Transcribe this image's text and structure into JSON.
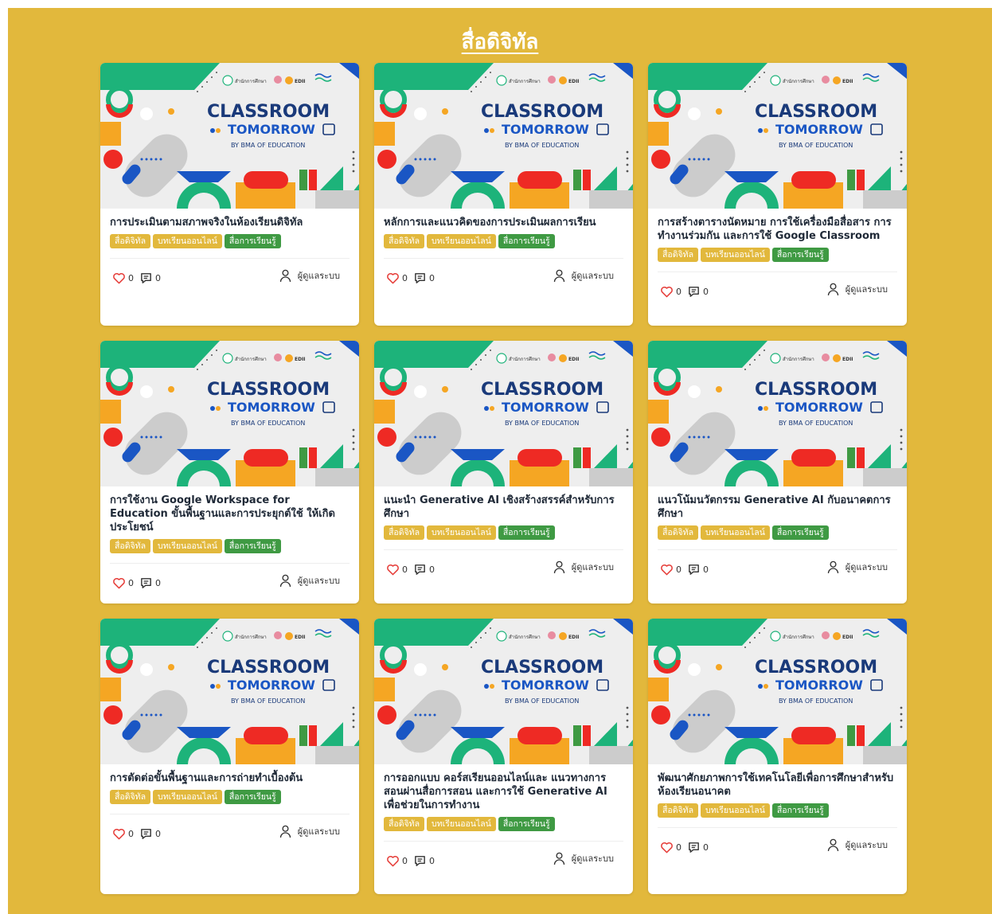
{
  "section": {
    "title": "สื่อดิจิทัล"
  },
  "thumbnail": {
    "brand_line1": "CLASSROOM",
    "brand_line2": "TOMORROW",
    "brand_line3": "BY BMA OF EDUCATION",
    "logo_text": "สำนักการศึกษา",
    "logo_edu": "EDII"
  },
  "tags": [
    "สื่อดิจิทัล",
    "บทเรียนออนไลน์",
    "สื่อการเรียนรู้"
  ],
  "cards": [
    {
      "title": "การประเมินตามสภาพจริงในห้องเรียนดิจิทัล",
      "likes": "0",
      "comments": "0",
      "author": "ผู้ดูแลระบบ"
    },
    {
      "title": "หลักการและแนวคิดของการประเมินผลการเรียน",
      "likes": "0",
      "comments": "0",
      "author": "ผู้ดูแลระบบ"
    },
    {
      "title": "การสร้างตารางนัดหมาย การใช้เครื่องมือสื่อสาร การทำงานร่วมกัน และการใช้ Google Classroom",
      "likes": "0",
      "comments": "0",
      "author": "ผู้ดูแลระบบ"
    },
    {
      "title": "การใช้งาน Google Workspace for Education ขั้นพื้นฐานและการประยุกต์ใช้ ให้เกิดประโยชน์",
      "likes": "0",
      "comments": "0",
      "author": "ผู้ดูแลระบบ"
    },
    {
      "title": "แนะนำ Generative AI เชิงสร้างสรรค์สำหรับการศึกษา",
      "likes": "0",
      "comments": "0",
      "author": "ผู้ดูแลระบบ"
    },
    {
      "title": "แนวโน้มนวัตกรรม Generative AI กับอนาคตการศึกษา",
      "likes": "0",
      "comments": "0",
      "author": "ผู้ดูแลระบบ"
    },
    {
      "title": "การตัดต่อขั้นพื้นฐานและการถ่ายทำเบื้องต้น",
      "likes": "0",
      "comments": "0",
      "author": "ผู้ดูแลระบบ"
    },
    {
      "title": "การออกแบบ คอร์สเรียนออนไลน์และ แนวทางการสอนผ่านสื่อการสอน และการใช้ Generative AI เพื่อช่วยในการทำงาน",
      "likes": "0",
      "comments": "0",
      "author": "ผู้ดูแลระบบ"
    },
    {
      "title": "พัฒนาศักยภาพการใช้เทคโนโลยีเพื่อการศึกษาสำหรับห้องเรียนอนาคต",
      "likes": "0",
      "comments": "0",
      "author": "ผู้ดูแลระบบ"
    }
  ],
  "colors": {
    "section_bg": "#e2b83c",
    "tag_yellow": "#e2b83c",
    "tag_green": "#3f9a43",
    "heart": "#e53935",
    "thumb_green": "#1db37a",
    "thumb_blue": "#1a56c4",
    "thumb_red": "#ee2a24",
    "thumb_orange": "#f5a623"
  }
}
